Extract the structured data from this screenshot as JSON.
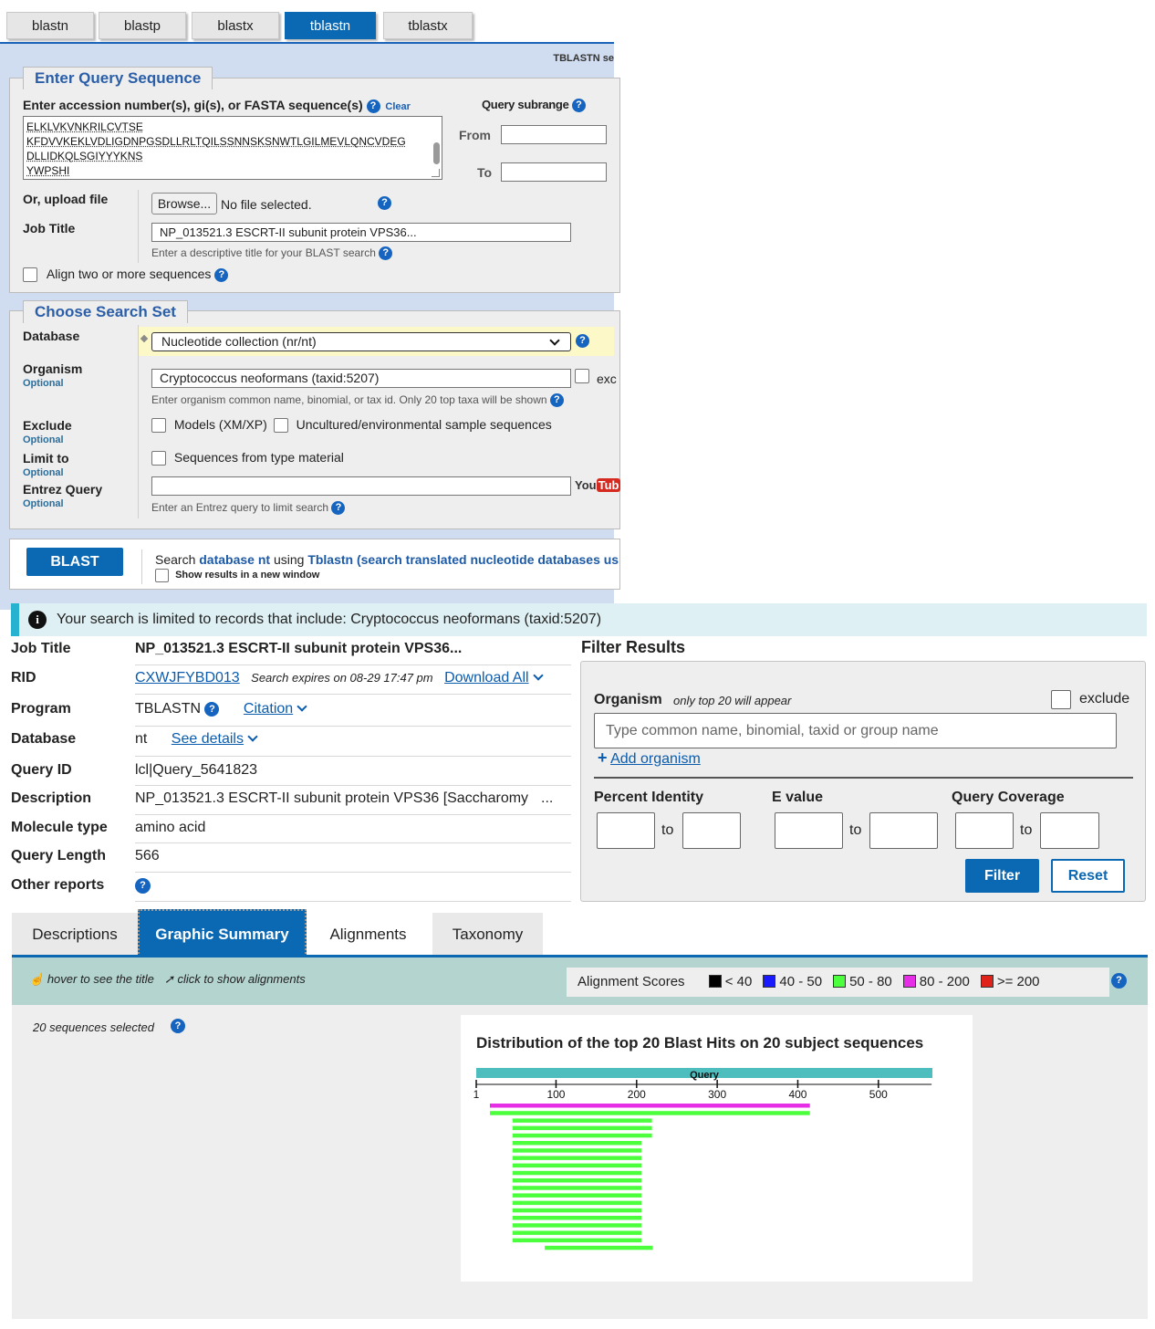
{
  "tabs": [
    "blastn",
    "blastp",
    "blastx",
    "tblastn",
    "tblastx"
  ],
  "active_tab": "tblastn",
  "form": {
    "page_label": "TBLASTN se",
    "query_legend": "Enter Query Sequence",
    "query_label": "Enter accession number(s), gi(s), or FASTA sequence(s)",
    "clear": "Clear",
    "sequence_lines": [
      "ELKLVKVNKRILCVTSE",
      "KFDVVKEKLVDLIGDNPGSDLLRLTQILSSNNSKSNWTLGILMEVLQNCVDEG",
      "DLLIDKQLSGIYYYKNS",
      "YWPSHI"
    ],
    "subrange_label": "Query subrange",
    "from_label": "From",
    "to_label": "To",
    "upload_label": "Or, upload file",
    "browse_button": "Browse...",
    "no_file": "No file selected.",
    "job_title_label": "Job Title",
    "job_title_value": "NP_013521.3 ESCRT-II subunit protein VPS36...",
    "job_title_hint": "Enter a descriptive title for your BLAST search",
    "align_two": "Align two or more sequences",
    "search_set_legend": "Choose Search Set",
    "database_label": "Database",
    "database_value": "Nucleotide collection (nr/nt)",
    "organism_label": "Organism",
    "optional": "Optional",
    "organism_value": "Cryptococcus neoformans (taxid:5207)",
    "organism_exclude": "exc",
    "organism_hint": "Enter organism common name, binomial, or tax id. Only 20 top taxa will be shown",
    "exclude_label": "Exclude",
    "exclude_models": "Models (XM/XP)",
    "exclude_uncultured": "Uncultured/environmental sample sequences",
    "limit_label": "Limit to",
    "limit_type": "Sequences from type material",
    "entrez_label": "Entrez Query",
    "entrez_hint": "Enter an Entrez query to limit search",
    "youtube": "You",
    "youtube_tube": "Tub",
    "blast_button": "BLAST",
    "search_prefix": "Search",
    "search_db": "database nt",
    "search_using": "using",
    "search_program": "Tblastn (search translated nucleotide databases us",
    "new_window": "Show results in a new window"
  },
  "notice": "Your search is limited to records that include: Cryptococcus neoformans (taxid:5207)",
  "summary": {
    "job_title_label": "Job Title",
    "job_title": "NP_013521.3 ESCRT-II subunit protein VPS36...",
    "rid_label": "RID",
    "rid": "CXWJFYBD013",
    "expires": "Search expires on 08-29 17:47 pm",
    "download_all": "Download All",
    "program_label": "Program",
    "program": "TBLASTN",
    "citation": "Citation",
    "database_label": "Database",
    "database": "nt",
    "see_details": "See details",
    "query_id_label": "Query ID",
    "query_id": "lcl|Query_5641823",
    "description_label": "Description",
    "description": "NP_013521.3 ESCRT-II subunit protein VPS36 [Saccharomy",
    "description_more": "...",
    "molecule_label": "Molecule type",
    "molecule": "amino acid",
    "length_label": "Query Length",
    "length": "566",
    "other_label": "Other reports"
  },
  "filter": {
    "title": "Filter Results",
    "organism_label": "Organism",
    "organism_note": "only top 20 will appear",
    "exclude": "exclude",
    "organism_placeholder": "Type common  name, binomial, taxid or group  name",
    "add_organism": "Add organism",
    "percent_identity": "Percent Identity",
    "e_value": "E value",
    "query_coverage": "Query Coverage",
    "to": "to",
    "filter_button": "Filter",
    "reset_button": "Reset"
  },
  "result_tabs": [
    "Descriptions",
    "Graphic Summary",
    "Alignments",
    "Taxonomy"
  ],
  "active_result_tab": "Graphic Summary",
  "graphic": {
    "hover_hint": "hover to see the title",
    "click_hint": "click to show alignments",
    "scores_label": "Alignment Scores",
    "score_bins": [
      {
        "label": "< 40",
        "color": "#000000"
      },
      {
        "label": "40 - 50",
        "color": "#1a1aff"
      },
      {
        "label": "50 - 80",
        "color": "#4cff3c"
      },
      {
        "label": "80 - 200",
        "color": "#e52ee5"
      },
      {
        "label": ">= 200",
        "color": "#e0231a"
      }
    ],
    "selected_count": "20 sequences selected",
    "chart_title": "Distribution of the top 20 Blast Hits on 20 subject sequences",
    "query_bar_label": "Query"
  },
  "chart_data": {
    "type": "bar",
    "title": "Distribution of the top 20 Blast Hits on 20 subject sequences",
    "query_length": 566,
    "xlim": [
      1,
      566
    ],
    "ticks": [
      1,
      100,
      200,
      300,
      400,
      500
    ],
    "hits": [
      {
        "start": 18,
        "end": 415,
        "color": "#e52ee5"
      },
      {
        "start": 18,
        "end": 415,
        "color": "#4cff3c"
      },
      {
        "start": 46,
        "end": 219,
        "color": "#4cff3c"
      },
      {
        "start": 46,
        "end": 219,
        "color": "#4cff3c"
      },
      {
        "start": 46,
        "end": 219,
        "color": "#4cff3c"
      },
      {
        "start": 46,
        "end": 206,
        "color": "#4cff3c"
      },
      {
        "start": 46,
        "end": 206,
        "color": "#4cff3c"
      },
      {
        "start": 46,
        "end": 206,
        "color": "#4cff3c"
      },
      {
        "start": 46,
        "end": 206,
        "color": "#4cff3c"
      },
      {
        "start": 46,
        "end": 206,
        "color": "#4cff3c"
      },
      {
        "start": 46,
        "end": 206,
        "color": "#4cff3c"
      },
      {
        "start": 46,
        "end": 206,
        "color": "#4cff3c"
      },
      {
        "start": 46,
        "end": 206,
        "color": "#4cff3c"
      },
      {
        "start": 46,
        "end": 206,
        "color": "#4cff3c"
      },
      {
        "start": 46,
        "end": 206,
        "color": "#4cff3c"
      },
      {
        "start": 46,
        "end": 206,
        "color": "#4cff3c"
      },
      {
        "start": 46,
        "end": 206,
        "color": "#4cff3c"
      },
      {
        "start": 46,
        "end": 206,
        "color": "#4cff3c"
      },
      {
        "start": 46,
        "end": 206,
        "color": "#4cff3c"
      },
      {
        "start": 86,
        "end": 220,
        "color": "#4cff3c"
      }
    ]
  }
}
